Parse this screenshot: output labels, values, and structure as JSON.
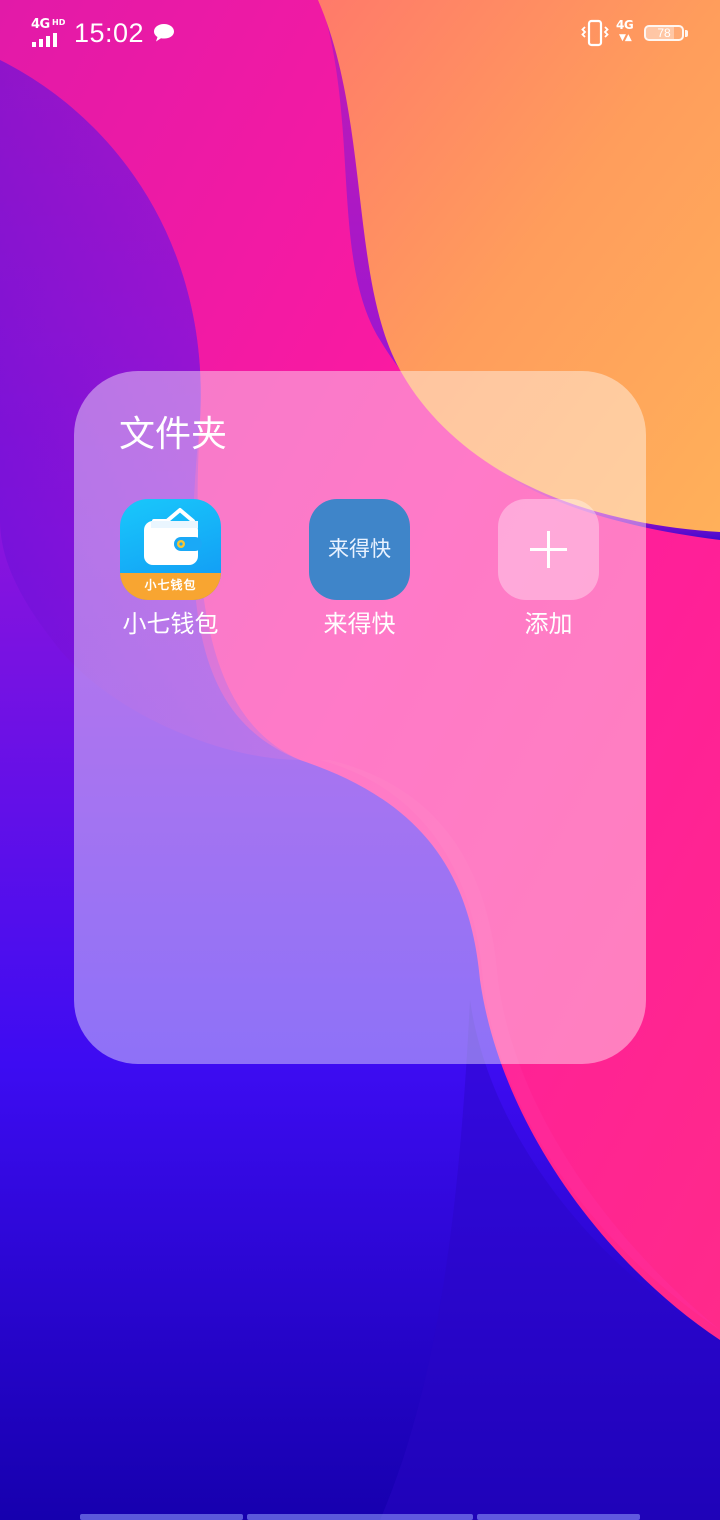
{
  "status_bar": {
    "network_type": "4G",
    "network_hd": "HD",
    "time": "15:02",
    "data_network": "4G",
    "battery_level": "78",
    "battery_fraction": 0.78
  },
  "folder": {
    "title": "文件夹",
    "apps": [
      {
        "label": "小七钱包",
        "icon": "wallet-icon",
        "icon_text": "小七钱包",
        "tile_color": "#1aa9f7",
        "band_color": "#f8a531"
      },
      {
        "label": "来得快",
        "icon": "text-logo",
        "icon_text": "来得快",
        "tile_color": "#3f85c9"
      },
      {
        "label": "添加",
        "icon": "plus-icon"
      }
    ]
  },
  "colors": {
    "wallpaper_orange": "#ffad5a",
    "wallpaper_pink": "#ff1ea6",
    "wallpaper_purple": "#9b14e2",
    "wallpaper_blue": "#3a0bf0",
    "wallpaper_navy": "#1a00a8"
  }
}
